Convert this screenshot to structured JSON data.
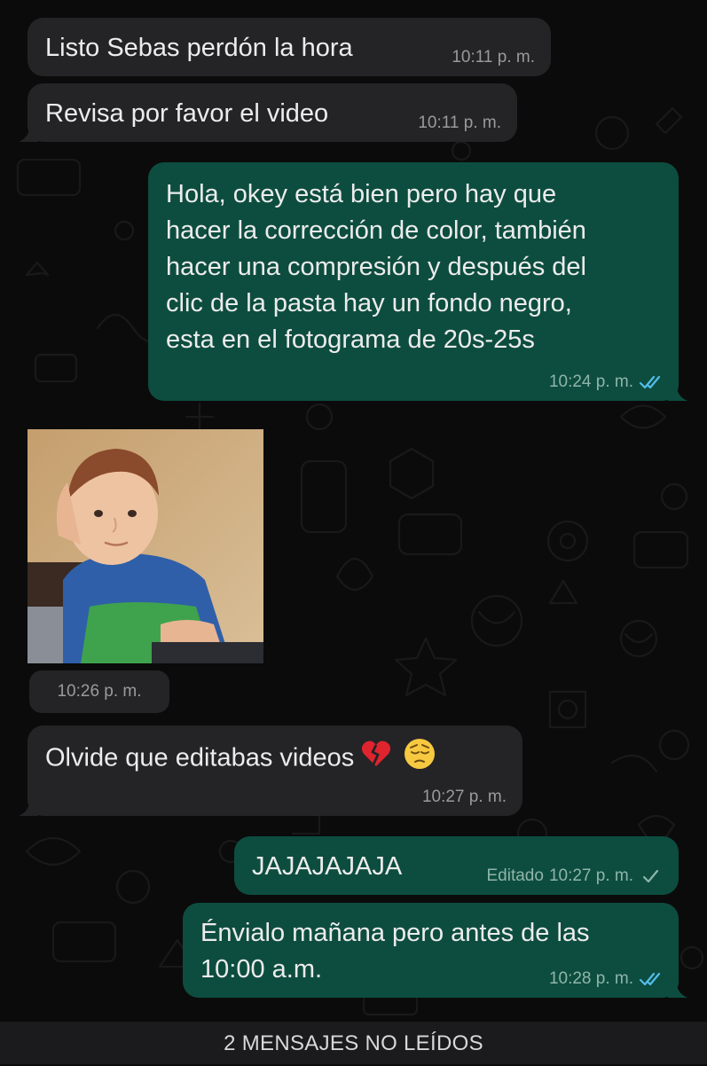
{
  "messages": [
    {
      "id": "m1",
      "direction": "incoming",
      "text": "Listo Sebas perdón la hora",
      "time": "10:11 p. m."
    },
    {
      "id": "m2",
      "direction": "incoming",
      "text": "Revisa por favor el video",
      "time": "10:11 p. m."
    },
    {
      "id": "m3",
      "direction": "outgoing",
      "text": "Hola, okey está bien pero hay que\nhacer la corrección de color, también\nhacer una compresión y después del\nclic de la pasta hay un fondo negro,\nesta en el fotograma de 20s-25s",
      "time": "10:24 p. m.",
      "status": "read"
    },
    {
      "id": "m4",
      "direction": "incoming",
      "type": "image",
      "image_icon": "child-reaction-photo",
      "time": "10:26 p. m."
    },
    {
      "id": "m5",
      "direction": "incoming",
      "text": "Olvide que editabas videos",
      "emojis": [
        "broken-heart-emoji",
        "pensive-face-emoji"
      ],
      "time": "10:27 p. m."
    },
    {
      "id": "m6",
      "direction": "outgoing",
      "text": "JAJAJAJAJA",
      "edited_label": "Editado",
      "time": "10:27 p. m.",
      "status": "sent"
    },
    {
      "id": "m7",
      "direction": "outgoing",
      "text": "Énvialo mañana pero antes de las\n10:00 a.m.",
      "time": "10:28 p. m.",
      "status": "read"
    }
  ],
  "unread_banner": "2 MENSAJES NO LEÍDOS",
  "colors": {
    "background": "#0b0b0b",
    "incoming_bubble": "#242426",
    "outgoing_bubble": "#0d4d3f",
    "read_tick": "#53bdeb",
    "sent_tick": "#8fb5aa"
  }
}
